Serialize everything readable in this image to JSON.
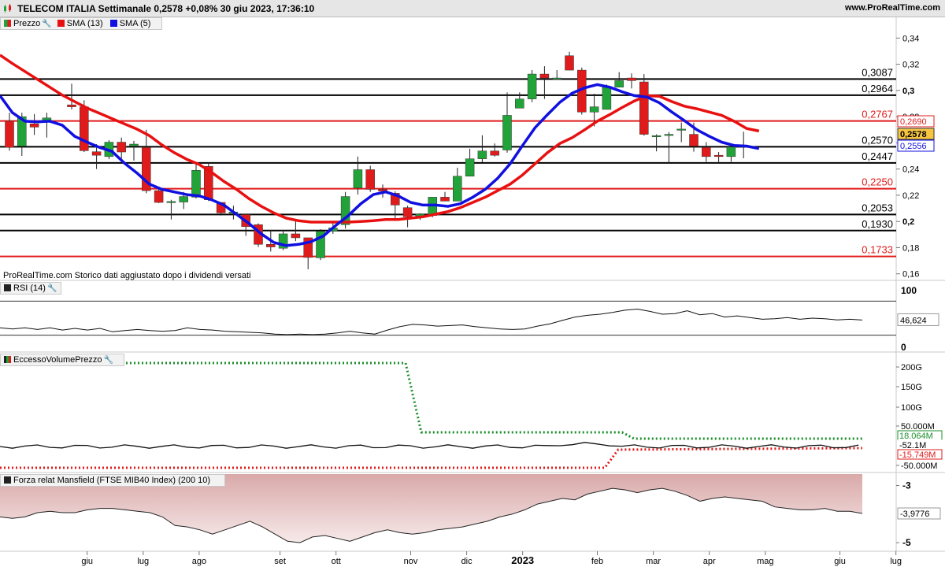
{
  "header": {
    "title": "TELECOM ITALIA Settimanale 0,2578 +0,08% 30 giu 2023, 17:36:10",
    "site": "www.ProRealTime.com"
  },
  "price_panel": {
    "legend": {
      "price": "Prezzo",
      "sma13": "SMA (13)",
      "sma5": "SMA (5)"
    },
    "note": "ProRealTime.com Storico dati aggiustato dopo i dividendi versati"
  },
  "rsi_panel": {
    "legend": "RSI (14)"
  },
  "volume_panel": {
    "legend": "EccessoVolumePrezzo"
  },
  "mansfield_panel": {
    "legend": "Forza relat Mansfield (FTSE MIB40 Index) (200 10)"
  },
  "colors": {
    "up": "#22a339",
    "down": "#e01b1b",
    "sma5": "#1010e0",
    "sma13": "#e81010",
    "hline_black": "#000000",
    "hline_red": "#e01b1b"
  },
  "chart_data": [
    {
      "type": "candlestick",
      "title": "TELECOM ITALIA Settimanale",
      "x_ticks": [
        "giu",
        "lug",
        "ago",
        "set",
        "ott",
        "nov",
        "dic",
        "2023",
        "feb",
        "mar",
        "apr",
        "mag",
        "giu",
        "lug"
      ],
      "x_tick_candle_index": [
        6.5,
        11,
        15.5,
        22,
        26.5,
        32.5,
        37,
        41.5,
        47.5,
        52,
        56.5,
        61,
        67,
        71.5
      ],
      "ylim": [
        0.155,
        0.345
      ],
      "y_ticks": [
        "0,34",
        "0,32",
        "0,3",
        "0,28",
        "0,26",
        "0,24",
        "0,22",
        "0,2",
        "0,18",
        "0,16"
      ],
      "y_tick_values": [
        0.34,
        0.32,
        0.3,
        0.28,
        0.26,
        0.24,
        0.22,
        0.2,
        0.18,
        0.16
      ],
      "candles": [
        {
          "o": 0.2765,
          "h": 0.283,
          "l": 0.254,
          "c": 0.2565
        },
        {
          "o": 0.2575,
          "h": 0.283,
          "l": 0.25,
          "c": 0.28
        },
        {
          "o": 0.2745,
          "h": 0.282,
          "l": 0.266,
          "c": 0.272
        },
        {
          "o": 0.276,
          "h": 0.283,
          "l": 0.264,
          "c": 0.279
        },
        {
          "o": 0.0,
          "h": 0.0,
          "l": 0.0,
          "c": 0.0
        },
        {
          "o": 0.289,
          "h": 0.3052,
          "l": 0.2855,
          "c": 0.2875
        },
        {
          "o": 0.2875,
          "h": 0.2925,
          "l": 0.253,
          "c": 0.254
        },
        {
          "o": 0.2532,
          "h": 0.259,
          "l": 0.24,
          "c": 0.2505
        },
        {
          "o": 0.2495,
          "h": 0.262,
          "l": 0.2475,
          "c": 0.2605
        },
        {
          "o": 0.2605,
          "h": 0.264,
          "l": 0.2465,
          "c": 0.253
        },
        {
          "o": 0.2575,
          "h": 0.2615,
          "l": 0.2465,
          "c": 0.259
        },
        {
          "o": 0.2565,
          "h": 0.27,
          "l": 0.2215,
          "c": 0.2235
        },
        {
          "o": 0.2235,
          "h": 0.226,
          "l": 0.214,
          "c": 0.2145
        },
        {
          "o": 0.2148,
          "h": 0.2165,
          "l": 0.2015,
          "c": 0.2152
        },
        {
          "o": 0.2148,
          "h": 0.2225,
          "l": 0.2095,
          "c": 0.219
        },
        {
          "o": 0.2185,
          "h": 0.2435,
          "l": 0.2175,
          "c": 0.239
        },
        {
          "o": 0.242,
          "h": 0.245,
          "l": 0.2155,
          "c": 0.2165
        },
        {
          "o": 0.2145,
          "h": 0.2145,
          "l": 0.2045,
          "c": 0.2065
        },
        {
          "o": 0.2065,
          "h": 0.212,
          "l": 0.2015,
          "c": 0.2072
        },
        {
          "o": 0.2052,
          "h": 0.2055,
          "l": 0.189,
          "c": 0.196
        },
        {
          "o": 0.1975,
          "h": 0.1985,
          "l": 0.1805,
          "c": 0.1825
        },
        {
          "o": 0.1825,
          "h": 0.1935,
          "l": 0.177,
          "c": 0.1805
        },
        {
          "o": 0.1795,
          "h": 0.1935,
          "l": 0.178,
          "c": 0.1905
        },
        {
          "o": 0.1905,
          "h": 0.2015,
          "l": 0.185,
          "c": 0.1875
        },
        {
          "o": 0.1875,
          "h": 0.1875,
          "l": 0.1635,
          "c": 0.1725
        },
        {
          "o": 0.1722,
          "h": 0.194,
          "l": 0.1705,
          "c": 0.1925
        },
        {
          "o": 0.1925,
          "h": 0.2005,
          "l": 0.1905,
          "c": 0.195
        },
        {
          "o": 0.1975,
          "h": 0.2225,
          "l": 0.1945,
          "c": 0.219
        },
        {
          "o": 0.2255,
          "h": 0.2495,
          "l": 0.2205,
          "c": 0.2395
        },
        {
          "o": 0.2395,
          "h": 0.2425,
          "l": 0.2225,
          "c": 0.2245
        },
        {
          "o": 0.2245,
          "h": 0.2282,
          "l": 0.2182,
          "c": 0.2232
        },
        {
          "o": 0.2215,
          "h": 0.223,
          "l": 0.2012,
          "c": 0.2125
        },
        {
          "o": 0.2105,
          "h": 0.212,
          "l": 0.1955,
          "c": 0.2035
        },
        {
          "o": 0.2042,
          "h": 0.2062,
          "l": 0.2012,
          "c": 0.2055
        },
        {
          "o": 0.2045,
          "h": 0.2185,
          "l": 0.2032,
          "c": 0.2185
        },
        {
          "o": 0.2185,
          "h": 0.2225,
          "l": 0.2155,
          "c": 0.2155
        },
        {
          "o": 0.2155,
          "h": 0.241,
          "l": 0.2155,
          "c": 0.2345
        },
        {
          "o": 0.2345,
          "h": 0.2555,
          "l": 0.2345,
          "c": 0.2478
        },
        {
          "o": 0.2478,
          "h": 0.2658,
          "l": 0.2452,
          "c": 0.2538
        },
        {
          "o": 0.2538,
          "h": 0.2595,
          "l": 0.2495,
          "c": 0.2505
        },
        {
          "o": 0.2545,
          "h": 0.2985,
          "l": 0.2525,
          "c": 0.281
        },
        {
          "o": 0.2865,
          "h": 0.2985,
          "l": 0.2875,
          "c": 0.2935
        },
        {
          "o": 0.2935,
          "h": 0.3155,
          "l": 0.291,
          "c": 0.3125
        },
        {
          "o": 0.3125,
          "h": 0.3185,
          "l": 0.2935,
          "c": 0.3095
        },
        {
          "o": 0.3095,
          "h": 0.3155,
          "l": 0.3095,
          "c": 0.3095
        },
        {
          "o": 0.3265,
          "h": 0.3295,
          "l": 0.3155,
          "c": 0.3155
        },
        {
          "o": 0.3155,
          "h": 0.3175,
          "l": 0.2815,
          "c": 0.2835
        },
        {
          "o": 0.2835,
          "h": 0.2975,
          "l": 0.2725,
          "c": 0.2875
        },
        {
          "o": 0.2855,
          "h": 0.3045,
          "l": 0.2855,
          "c": 0.3025
        },
        {
          "o": 0.3025,
          "h": 0.314,
          "l": 0.3025,
          "c": 0.3075
        },
        {
          "o": 0.3095,
          "h": 0.313,
          "l": 0.3015,
          "c": 0.3075
        },
        {
          "o": 0.3065,
          "h": 0.3125,
          "l": 0.2655,
          "c": 0.2665
        },
        {
          "o": 0.2655,
          "h": 0.2665,
          "l": 0.2535,
          "c": 0.2655
        },
        {
          "o": 0.2662,
          "h": 0.2682,
          "l": 0.2445,
          "c": 0.2665
        },
        {
          "o": 0.2705,
          "h": 0.2755,
          "l": 0.2605,
          "c": 0.2705
        },
        {
          "o": 0.2665,
          "h": 0.2755,
          "l": 0.2532,
          "c": 0.2575
        },
        {
          "o": 0.2565,
          "h": 0.2605,
          "l": 0.2455,
          "c": 0.2495
        },
        {
          "o": 0.2505,
          "h": 0.253,
          "l": 0.2445,
          "c": 0.2495
        },
        {
          "o": 0.2495,
          "h": 0.2575,
          "l": 0.2455,
          "c": 0.2568
        },
        {
          "o": 0.2575,
          "h": 0.2685,
          "l": 0.2482,
          "c": 0.2578
        }
      ],
      "sma5": [
        0.296,
        0.283,
        0.2765,
        0.276,
        0.2765,
        0.2735,
        0.265,
        0.2605,
        0.2565,
        0.2535,
        0.2445,
        0.237,
        0.2285,
        0.2245,
        0.2225,
        0.2205,
        0.2195,
        0.2165,
        0.2125,
        0.2055,
        0.1985,
        0.1905,
        0.184,
        0.1815,
        0.1825,
        0.1845,
        0.189,
        0.197,
        0.2045,
        0.2135,
        0.2205,
        0.2225,
        0.2195,
        0.2145,
        0.2125,
        0.2125,
        0.2115,
        0.2135,
        0.2185,
        0.2245,
        0.233,
        0.244,
        0.258,
        0.2715,
        0.2815,
        0.291,
        0.298,
        0.302,
        0.3045,
        0.3025,
        0.299,
        0.296,
        0.295,
        0.2905,
        0.2835,
        0.277,
        0.27,
        0.265,
        0.2605,
        0.258,
        0.2575,
        0.2556
      ],
      "sma13": [
        0.327,
        0.3205,
        0.3145,
        0.3085,
        0.3025,
        0.2965,
        0.2915,
        0.2865,
        0.2825,
        0.2785,
        0.2745,
        0.2705,
        0.2655,
        0.2585,
        0.2525,
        0.2475,
        0.2435,
        0.2375,
        0.2305,
        0.2245,
        0.2175,
        0.2115,
        0.2065,
        0.2025,
        0.2005,
        0.1995,
        0.1995,
        0.1995,
        0.1995,
        0.2,
        0.2005,
        0.2015,
        0.2015,
        0.2025,
        0.2035,
        0.2055,
        0.2075,
        0.2105,
        0.2145,
        0.2185,
        0.2235,
        0.2285,
        0.2355,
        0.244,
        0.2525,
        0.2595,
        0.264,
        0.27,
        0.2765,
        0.2815,
        0.287,
        0.292,
        0.296,
        0.2955,
        0.2915,
        0.288,
        0.286,
        0.2835,
        0.281,
        0.2765,
        0.271,
        0.269
      ],
      "h_lines": [
        {
          "value": 0.3087,
          "label": "0,3087",
          "color": "black"
        },
        {
          "value": 0.2964,
          "label": "0,2964",
          "color": "black"
        },
        {
          "value": 0.2767,
          "label": "0,2767",
          "color": "red"
        },
        {
          "value": 0.257,
          "label": "0,2570",
          "color": "black"
        },
        {
          "value": 0.2447,
          "label": "0,2447",
          "color": "black"
        },
        {
          "value": 0.225,
          "label": "0,2250",
          "color": "red"
        },
        {
          "value": 0.2053,
          "label": "0,2053",
          "color": "black"
        },
        {
          "value": 0.193,
          "label": "0,1930",
          "color": "black"
        },
        {
          "value": 0.1733,
          "label": "0,1733",
          "color": "red"
        }
      ],
      "last_values": [
        {
          "label": "0,2690",
          "color": "red"
        },
        {
          "label": "0,2578",
          "color": "gold"
        },
        {
          "label": "0,2556",
          "color": "blue"
        }
      ]
    },
    {
      "type": "line",
      "title": "RSI (14)",
      "ylim": [
        0,
        100
      ],
      "y_ticks": [
        "100",
        "0"
      ],
      "bands": [
        80,
        20
      ],
      "values": [
        33,
        31,
        33,
        30,
        33,
        29,
        32,
        29,
        32,
        26,
        28,
        30,
        28,
        27,
        28,
        33,
        30,
        29,
        27,
        26,
        25,
        24,
        22,
        21,
        22,
        21,
        22,
        24,
        27,
        24,
        22,
        29,
        35,
        39,
        38,
        36,
        37,
        38,
        35,
        33,
        31,
        30,
        31,
        36,
        40,
        46,
        52,
        55,
        57,
        60,
        64,
        66,
        62,
        57,
        58,
        63,
        56,
        58,
        52,
        54,
        51,
        48,
        49,
        51,
        48,
        50,
        49,
        47,
        48,
        46.624
      ],
      "last_value": "46,624"
    },
    {
      "type": "line",
      "title": "EccessoVolumePrezzo",
      "y_ticks": [
        "200G",
        "150G",
        "100G",
        "50.000M",
        "-50.000M"
      ],
      "last_values": [
        {
          "label": "18.064M",
          "color": "green"
        },
        {
          "label": "-52.1M",
          "color": "black"
        },
        {
          "label": "-15.749M",
          "color": "red"
        }
      ]
    },
    {
      "type": "area",
      "title": "Forza relat Mansfield (FTSE MIB40 Index) (200 10)",
      "ylim": [
        -5.3,
        -2.6
      ],
      "y_ticks": [
        "-3",
        "-5"
      ],
      "y_tick_values": [
        -3,
        -5
      ],
      "values": [
        -4.1,
        -4.15,
        -4.1,
        -3.95,
        -3.9,
        -3.95,
        -3.95,
        -3.85,
        -3.8,
        -3.8,
        -3.85,
        -3.9,
        -3.95,
        -4.1,
        -4.4,
        -4.45,
        -4.55,
        -4.7,
        -4.55,
        -4.4,
        -4.25,
        -4.45,
        -4.7,
        -4.95,
        -5.0,
        -4.8,
        -4.75,
        -4.85,
        -4.95,
        -4.8,
        -4.65,
        -4.55,
        -4.65,
        -4.7,
        -4.65,
        -4.55,
        -4.5,
        -4.45,
        -4.35,
        -4.25,
        -4.1,
        -4.0,
        -3.85,
        -3.65,
        -3.55,
        -3.45,
        -3.5,
        -3.3,
        -3.2,
        -3.1,
        -3.15,
        -3.25,
        -3.15,
        -3.1,
        -3.2,
        -3.35,
        -3.55,
        -3.45,
        -3.4,
        -3.45,
        -3.5,
        -3.55,
        -3.75,
        -3.8,
        -3.85,
        -3.85,
        -3.8,
        -3.9,
        -3.9,
        -3.9776
      ],
      "last_value": "-3,9776"
    }
  ]
}
